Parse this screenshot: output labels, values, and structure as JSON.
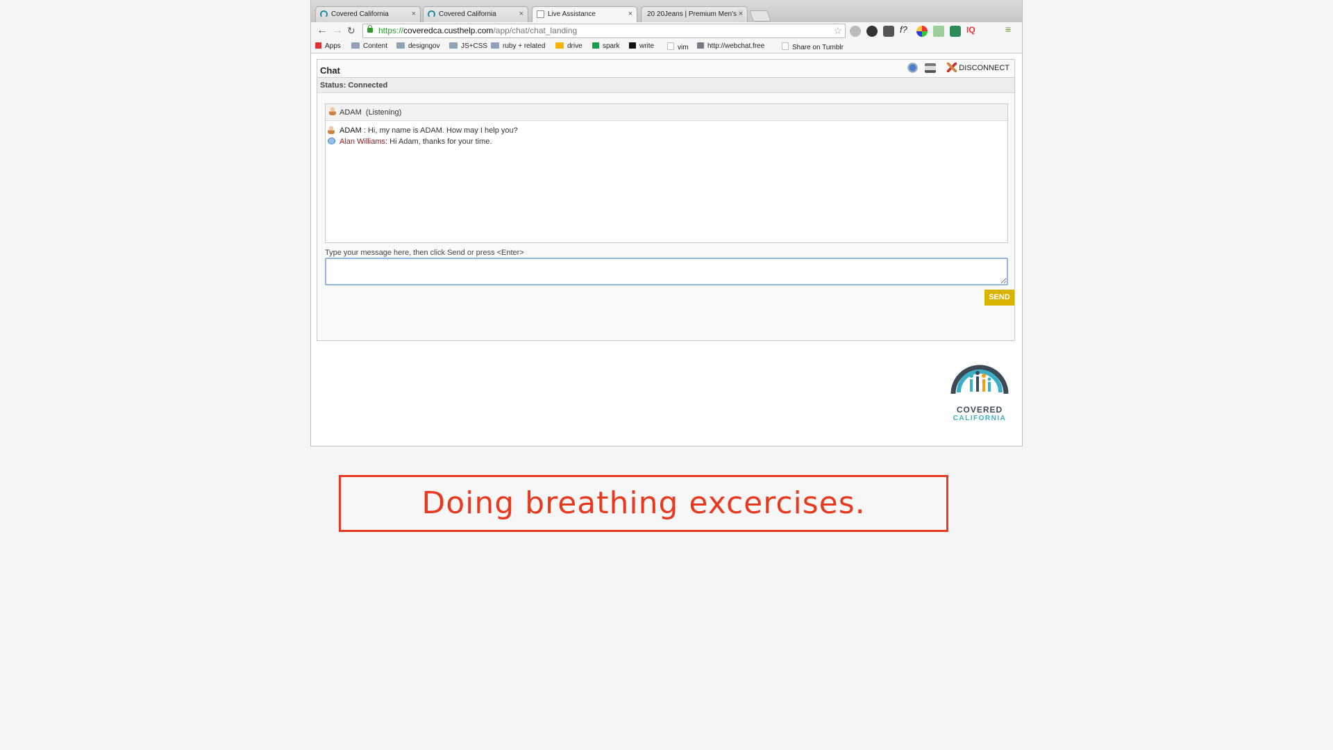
{
  "browser": {
    "tabs": [
      {
        "label": "Covered California",
        "icon": "covered-favicon",
        "active": false
      },
      {
        "label": "Covered California",
        "icon": "covered-favicon",
        "active": false
      },
      {
        "label": "Live Assistance",
        "icon": "doc-favicon",
        "active": true
      },
      {
        "label": "20 20Jeans | Premium Men's J",
        "icon": "none",
        "active": false
      }
    ],
    "url": {
      "scheme": "https://",
      "host": "coveredca.custhelp.com",
      "path": "/app/chat/chat_landing"
    },
    "bookmarks": [
      "Apps",
      "Content",
      "designgov",
      "JS+CSS",
      "ruby + related",
      "drive",
      "spark",
      "write",
      "vim",
      "http://webchat.free",
      "Share on Tumblr"
    ]
  },
  "chat": {
    "title": "Chat",
    "disconnect_label": "DISCONNECT",
    "status": "Status: Connected",
    "agent_name": "ADAM",
    "agent_state": "(Listening)",
    "messages": [
      {
        "sender": "ADAM",
        "text": " : Hi, my name is ADAM. How may I help you?",
        "role": "agent"
      },
      {
        "sender": "Alan Williams",
        "text": ": Hi Adam, thanks for your time.",
        "role": "client"
      }
    ],
    "input_label": "Type your message here, then click Send or press <Enter>",
    "input_value": "",
    "send_label": "SEND"
  },
  "logo": {
    "line1": "COVERED",
    "line2": "CALIFORNIA"
  },
  "caption": "Doing breathing excercises.",
  "colors": {
    "send": "#d8b400",
    "caption": "#e8391f",
    "client_name": "#8b1a1a",
    "logo_teal": "#3ab0c8"
  }
}
